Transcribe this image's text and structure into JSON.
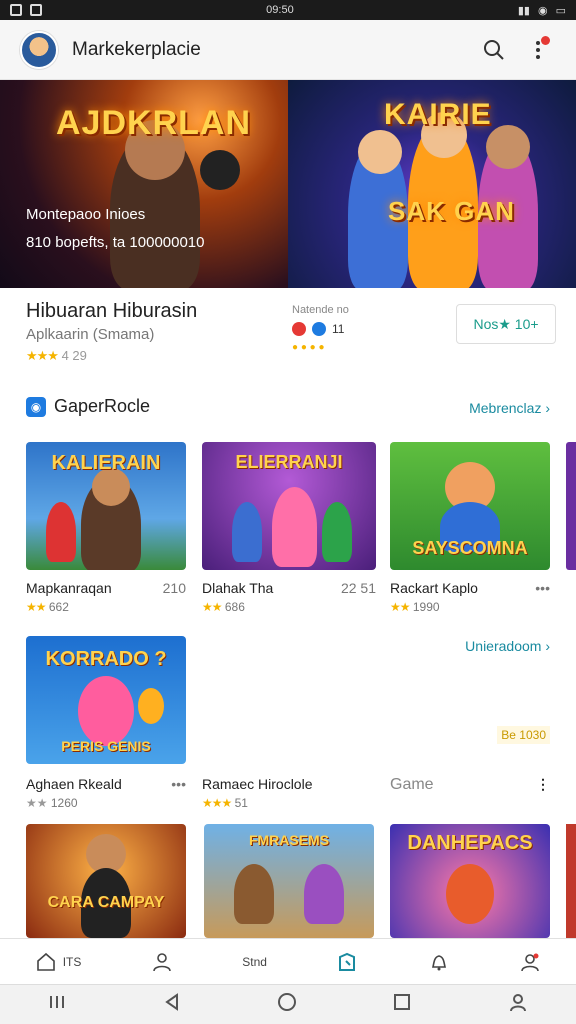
{
  "status": {
    "center": "09:50"
  },
  "appbar": {
    "title": "Markekerplacie"
  },
  "hero": {
    "left": {
      "title": "AJDKRLAN",
      "subtitle": "Montepaoo Inioes",
      "meta": "810 bopefts, ta 100000010"
    },
    "right": {
      "title": "KAIRIE",
      "subtitle": "SAK GAN"
    }
  },
  "info": {
    "title": "Hibuaran Hiburasin",
    "subtitle": "Aplkaarin (Smama)",
    "rating": "4 29",
    "mid_label": "Natende no",
    "mid_value": "11",
    "pill": "Nos★ 10+"
  },
  "section1": {
    "title": "GaperRocle",
    "link": "Mebrenclaz ›"
  },
  "row1": [
    {
      "title": "Mapkanraqan",
      "num": "210",
      "rating": "662",
      "art": "KALIERAIN"
    },
    {
      "title": "Dlahak Tha",
      "num": "22 51",
      "rating": "686",
      "art": "ELIERRANJI"
    },
    {
      "title": "Rackart Kaplo",
      "num": "•••",
      "rating": "1990",
      "art": "SAYSCOMNA"
    }
  ],
  "section2": {
    "link": "Unieradoom ›",
    "tag": "Be 1030"
  },
  "row2": [
    {
      "title": "Aghaen Rkeald",
      "num": "•••",
      "rating": "1260",
      "art": "KORRADO ?",
      "sub": "PERIS GENIS"
    },
    {
      "title": "Ramaec Hiroclole",
      "rating": "51"
    },
    {
      "title": "Game",
      "num": "⋮"
    }
  ],
  "row3": [
    {
      "art": "CARA CAMPAY"
    },
    {
      "art": "FMRASEMS"
    },
    {
      "art": "DANHEPACS"
    }
  ],
  "bottomnav": {
    "home": "ITS",
    "store": "Stnd"
  },
  "colors": {
    "accent": "#1a8ba0",
    "star": "#f5b400",
    "link": "#1a8ba0"
  }
}
